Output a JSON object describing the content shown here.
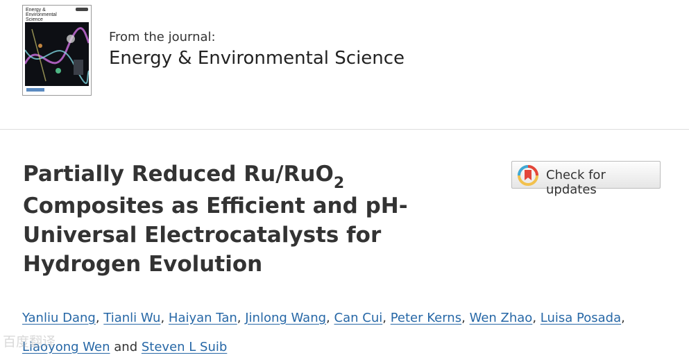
{
  "journal": {
    "from_label": "From the journal:",
    "name": "Energy & Environmental Science",
    "cover_title": "Energy & Environmental Science"
  },
  "article": {
    "title_line1_main": "Partially Reduced Ru/RuO",
    "title_line1_subscript": "2",
    "title_rest": "Composites as Efficient and pH-Universal Electrocatalysts for Hydrogen Evolution"
  },
  "updates_button": {
    "label": "Check for updates",
    "icon": "check-for-updates-icon"
  },
  "authors": {
    "list": [
      "Yanliu Dang",
      "Tianli Wu",
      "Haiyan Tan",
      "Jinlong Wang",
      "Can Cui",
      "Peter Kerns",
      "Wen Zhao",
      "Luisa Posada",
      "Liaoyong Wen",
      "Steven L Suib"
    ],
    "separator": ",",
    "conjunction": "and"
  },
  "watermark": {
    "text": "百度翻译"
  },
  "colors": {
    "link": "#2667a6",
    "title": "#333333",
    "divider": "#dddddd"
  }
}
